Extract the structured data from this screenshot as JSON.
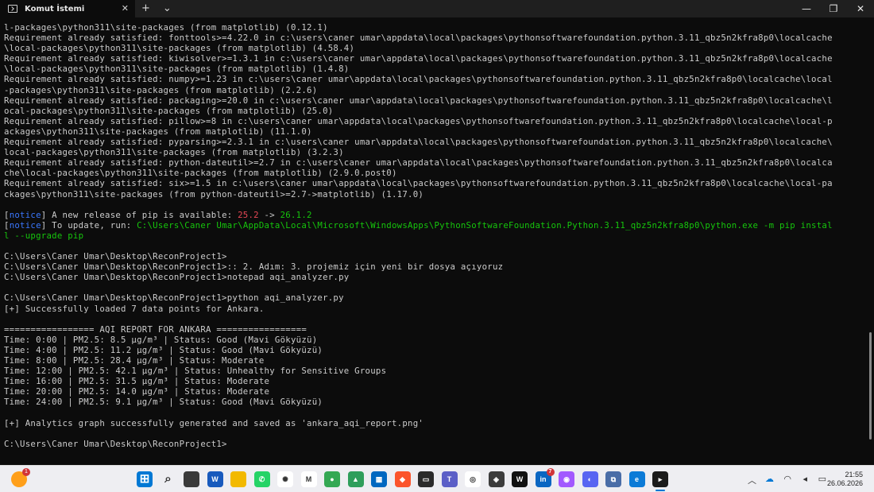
{
  "window": {
    "tab_title": "Komut İstemi",
    "new_tab": "+",
    "dropdown": "⌄",
    "tab_close": "✕",
    "minimize": "—",
    "maximize": "❐",
    "close": "✕"
  },
  "console": {
    "lines": [
      [
        {
          "t": "l-packages\\python311\\site-packages (from matplotlib) (0.12.1)"
        }
      ],
      [
        {
          "t": "Requirement already satisfied: fonttools>=4.22.0 in c:\\users\\caner umar\\appdata\\local\\packages\\pythonsoftwarefoundation.python.3.11_qbz5n2kfra8p0\\localcache"
        }
      ],
      [
        {
          "t": "\\local-packages\\python311\\site-packages (from matplotlib) (4.58.4)"
        }
      ],
      [
        {
          "t": "Requirement already satisfied: kiwisolver>=1.3.1 in c:\\users\\caner umar\\appdata\\local\\packages\\pythonsoftwarefoundation.python.3.11_qbz5n2kfra8p0\\localcache"
        }
      ],
      [
        {
          "t": "\\local-packages\\python311\\site-packages (from matplotlib) (1.4.8)"
        }
      ],
      [
        {
          "t": "Requirement already satisfied: numpy>=1.23 in c:\\users\\caner umar\\appdata\\local\\packages\\pythonsoftwarefoundation.python.3.11_qbz5n2kfra8p0\\localcache\\local"
        }
      ],
      [
        {
          "t": "-packages\\python311\\site-packages (from matplotlib) (2.2.6)"
        }
      ],
      [
        {
          "t": "Requirement already satisfied: packaging>=20.0 in c:\\users\\caner umar\\appdata\\local\\packages\\pythonsoftwarefoundation.python.3.11_qbz5n2kfra8p0\\localcache\\l"
        }
      ],
      [
        {
          "t": "ocal-packages\\python311\\site-packages (from matplotlib) (25.0)"
        }
      ],
      [
        {
          "t": "Requirement already satisfied: pillow>=8 in c:\\users\\caner umar\\appdata\\local\\packages\\pythonsoftwarefoundation.python.3.11_qbz5n2kfra8p0\\localcache\\local-p"
        }
      ],
      [
        {
          "t": "ackages\\python311\\site-packages (from matplotlib) (11.1.0)"
        }
      ],
      [
        {
          "t": "Requirement already satisfied: pyparsing>=2.3.1 in c:\\users\\caner umar\\appdata\\local\\packages\\pythonsoftwarefoundation.python.3.11_qbz5n2kfra8p0\\localcache\\"
        }
      ],
      [
        {
          "t": "local-packages\\python311\\site-packages (from matplotlib) (3.2.3)"
        }
      ],
      [
        {
          "t": "Requirement already satisfied: python-dateutil>=2.7 in c:\\users\\caner umar\\appdata\\local\\packages\\pythonsoftwarefoundation.python.3.11_qbz5n2kfra8p0\\localca"
        }
      ],
      [
        {
          "t": "che\\local-packages\\python311\\site-packages (from matplotlib) (2.9.0.post0)"
        }
      ],
      [
        {
          "t": "Requirement already satisfied: six>=1.5 in c:\\users\\caner umar\\appdata\\local\\packages\\pythonsoftwarefoundation.python.3.11_qbz5n2kfra8p0\\localcache\\local-pa"
        }
      ],
      [
        {
          "t": "ckages\\python311\\site-packages (from python-dateutil>=2.7->matplotlib) (1.17.0)"
        }
      ],
      [],
      [
        {
          "t": "["
        },
        {
          "t": "notice",
          "c": "blue"
        },
        {
          "t": "] A new release of pip is available: "
        },
        {
          "t": "25.2",
          "c": "red"
        },
        {
          "t": " -> "
        },
        {
          "t": "26.1.2",
          "c": "green"
        }
      ],
      [
        {
          "t": "["
        },
        {
          "t": "notice",
          "c": "blue"
        },
        {
          "t": "] To update, run: "
        },
        {
          "t": "C:\\Users\\Caner Umar\\AppData\\Local\\Microsoft\\WindowsApps\\PythonSoftwareFoundation.Python.3.11_qbz5n2kfra8p0\\python.exe -m pip instal",
          "c": "green"
        }
      ],
      [
        {
          "t": "l --upgrade pip",
          "c": "green"
        }
      ],
      [],
      [
        {
          "t": "C:\\Users\\Caner Umar\\Desktop\\ReconProject1>"
        }
      ],
      [
        {
          "t": "C:\\Users\\Caner Umar\\Desktop\\ReconProject1>:: 2. Adım: 3. projemiz için yeni bir dosya açıyoruz"
        }
      ],
      [
        {
          "t": "C:\\Users\\Caner Umar\\Desktop\\ReconProject1>notepad aqi_analyzer.py"
        }
      ],
      [],
      [
        {
          "t": "C:\\Users\\Caner Umar\\Desktop\\ReconProject1>python aqi_analyzer.py"
        }
      ],
      [
        {
          "t": "[+] Successfully loaded 7 data points for Ankara."
        }
      ],
      [],
      [
        {
          "t": "================= AQI REPORT FOR ANKARA ================="
        }
      ],
      [
        {
          "t": "Time: 0:00 | PM2.5: 8.5 µg/m³ | Status: Good (Mavi Gökyüzü)"
        }
      ],
      [
        {
          "t": "Time: 4:00 | PM2.5: 11.2 µg/m³ | Status: Good (Mavi Gökyüzü)"
        }
      ],
      [
        {
          "t": "Time: 8:00 | PM2.5: 28.4 µg/m³ | Status: Moderate"
        }
      ],
      [
        {
          "t": "Time: 12:00 | PM2.5: 42.1 µg/m³ | Status: Unhealthy for Sensitive Groups"
        }
      ],
      [
        {
          "t": "Time: 16:00 | PM2.5: 31.5 µg/m³ | Status: Moderate"
        }
      ],
      [
        {
          "t": "Time: 20:00 | PM2.5: 14.0 µg/m³ | Status: Moderate"
        }
      ],
      [
        {
          "t": "Time: 24:00 | PM2.5: 9.1 µg/m³ | Status: Good (Mavi Gökyüzü)"
        }
      ],
      [],
      [
        {
          "t": "[+] Analytics graph successfully generated and saved as 'ankara_aqi_report.png'"
        }
      ],
      [],
      [
        {
          "t": "C:\\Users\\Caner Umar\\Desktop\\ReconProject1>"
        }
      ]
    ]
  },
  "taskbar": {
    "weather_badge": "1",
    "apps": [
      {
        "name": "start-menu-icon",
        "color": "#0078d4",
        "glyph": "⊞"
      },
      {
        "name": "search-icon",
        "color": "transparent",
        "glyph": "⌕"
      },
      {
        "name": "task-view-icon",
        "color": "#3a3a3a",
        "glyph": ""
      },
      {
        "name": "word-icon",
        "color": "#185abd",
        "glyph": "W"
      },
      {
        "name": "file-explorer-icon",
        "color": "#f2b900",
        "glyph": ""
      },
      {
        "name": "whatsapp-icon",
        "color": "#25d366",
        "glyph": "✆"
      },
      {
        "name": "chatgpt-icon",
        "color": "#ffffff",
        "glyph": "✺"
      },
      {
        "name": "gmail-icon",
        "color": "#ffffff",
        "glyph": "M"
      },
      {
        "name": "chrome-icon",
        "color": "#34a853",
        "glyph": "●"
      },
      {
        "name": "photos-icon",
        "color": "#2e9e5b",
        "glyph": "▲"
      },
      {
        "name": "microsoft-store-icon",
        "color": "#0067c0",
        "glyph": "▦"
      },
      {
        "name": "brave-icon",
        "color": "#fb542b",
        "glyph": "◆"
      },
      {
        "name": "terminal-app-icon",
        "color": "#2b2b2b",
        "glyph": "▭"
      },
      {
        "name": "teams-icon",
        "color": "#5b5fc7",
        "glyph": "T"
      },
      {
        "name": "copilot-icon",
        "color": "#ffffff",
        "glyph": "◎"
      },
      {
        "name": "github-icon",
        "color": "#3c3c3c",
        "glyph": "◈"
      },
      {
        "name": "wikipedia-icon",
        "color": "#111111",
        "glyph": "W"
      },
      {
        "name": "linkedin-icon",
        "color": "#0a66c2",
        "glyph": "in",
        "badge": "7"
      },
      {
        "name": "figma-icon",
        "color": "#a259ff",
        "glyph": "◉"
      },
      {
        "name": "discord-icon",
        "color": "#5865f2",
        "glyph": "◐"
      },
      {
        "name": "network-app-icon",
        "color": "#4a6da7",
        "glyph": "⧉"
      },
      {
        "name": "edge-icon",
        "color": "#0c7bd7",
        "glyph": "e"
      },
      {
        "name": "command-prompt-icon",
        "color": "#1b1b1b",
        "glyph": "▸"
      }
    ],
    "date": "26.06.2026",
    "time": "21:55",
    "chevron_up": "︿"
  }
}
